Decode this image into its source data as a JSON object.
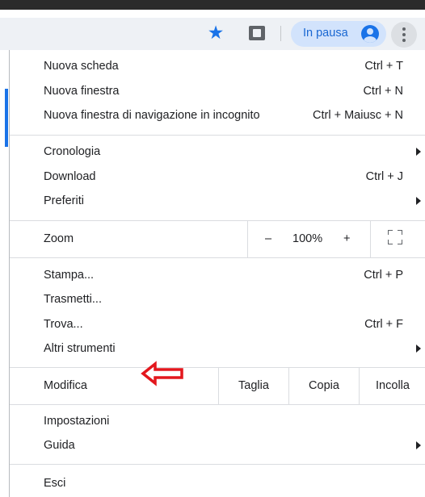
{
  "toolbar": {
    "paused_label": "In pausa",
    "icons": [
      "star-icon",
      "extension-icon",
      "avatar-icon",
      "more-vert-icon"
    ]
  },
  "menu": {
    "new_tab": {
      "label": "Nuova scheda",
      "shortcut": "Ctrl + T"
    },
    "new_window": {
      "label": "Nuova finestra",
      "shortcut": "Ctrl + N"
    },
    "incognito": {
      "label": "Nuova finestra di navigazione in incognito",
      "shortcut": "Ctrl + Maiusc + N"
    },
    "history": {
      "label": "Cronologia"
    },
    "downloads": {
      "label": "Download",
      "shortcut": "Ctrl + J"
    },
    "bookmarks": {
      "label": "Preferiti"
    },
    "zoom": {
      "label": "Zoom",
      "minus": "–",
      "value": "100%",
      "plus": "+"
    },
    "print": {
      "label": "Stampa...",
      "shortcut": "Ctrl + P"
    },
    "cast": {
      "label": "Trasmetti..."
    },
    "find": {
      "label": "Trova...",
      "shortcut": "Ctrl + F"
    },
    "more_tools": {
      "label": "Altri strumenti"
    },
    "edit": {
      "label": "Modifica",
      "cut": "Taglia",
      "copy": "Copia",
      "paste": "Incolla"
    },
    "settings": {
      "label": "Impostazioni"
    },
    "help": {
      "label": "Guida"
    },
    "exit": {
      "label": "Esci"
    }
  },
  "colors": {
    "accent": "#1a73e8",
    "annotation_arrow": "#e3171d"
  }
}
